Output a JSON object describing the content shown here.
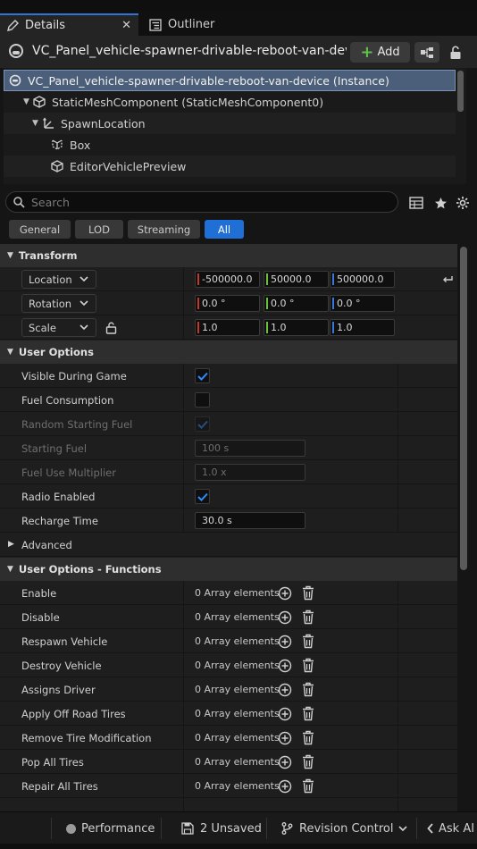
{
  "tabs": [
    {
      "label": "Details",
      "icon": "pencil-icon",
      "closable": true
    },
    {
      "label": "Outliner",
      "icon": "list-icon"
    }
  ],
  "header": {
    "actor_name": "VC_Panel_vehicle-spawner-drivable-reboot-van-device",
    "add_label": "Add"
  },
  "tree": [
    {
      "label": "VC_Panel_vehicle-spawner-drivable-reboot-van-device (Instance)",
      "icon": "actor-icon",
      "selected": true
    },
    {
      "label": "StaticMeshComponent (StaticMeshComponent0)",
      "icon": "cube-icon"
    },
    {
      "label": "SpawnLocation",
      "icon": "transform-icon"
    },
    {
      "label": "Box",
      "icon": "box-shape-icon"
    },
    {
      "label": "EditorVehiclePreview",
      "icon": "cube-icon"
    }
  ],
  "search": {
    "placeholder": "Search"
  },
  "filters": [
    "General",
    "LOD",
    "Streaming",
    "All"
  ],
  "active_filter": "All",
  "transform": {
    "title": "Transform",
    "rows": [
      {
        "label": "Location",
        "x": "-500000.0",
        "y": "50000.0",
        "z": "500000.0"
      },
      {
        "label": "Rotation",
        "x": "0.0 °",
        "y": "0.0 °",
        "z": "0.0 °"
      },
      {
        "label": "Scale",
        "x": "1.0",
        "y": "1.0",
        "z": "1.0"
      }
    ]
  },
  "user_options": {
    "title": "User Options",
    "rows": [
      {
        "label": "Visible During Game",
        "type": "checkbox",
        "checked": true,
        "enabled": true
      },
      {
        "label": "Fuel Consumption",
        "type": "checkbox",
        "checked": false,
        "enabled": true
      },
      {
        "label": "Random Starting Fuel",
        "type": "checkbox",
        "checked": true,
        "enabled": false
      },
      {
        "label": "Starting Fuel",
        "type": "number",
        "value": "100 s",
        "enabled": false
      },
      {
        "label": "Fuel Use Multiplier",
        "type": "number",
        "value": "1.0 x",
        "enabled": false
      },
      {
        "label": "Radio Enabled",
        "type": "checkbox",
        "checked": true,
        "enabled": true
      },
      {
        "label": "Recharge Time",
        "type": "number",
        "value": "30.0 s",
        "enabled": true
      }
    ]
  },
  "advanced_label": "Advanced",
  "functions": {
    "title": "User Options - Functions",
    "rows": [
      {
        "label": "Enable",
        "value": "0 Array elements"
      },
      {
        "label": "Disable",
        "value": "0 Array elements"
      },
      {
        "label": "Respawn Vehicle",
        "value": "0 Array elements"
      },
      {
        "label": "Destroy Vehicle",
        "value": "0 Array elements"
      },
      {
        "label": "Assigns Driver",
        "value": "0 Array elements"
      },
      {
        "label": "Apply Off Road Tires",
        "value": "0 Array elements"
      },
      {
        "label": "Remove Tire Modification",
        "value": "0 Array elements"
      },
      {
        "label": "Pop All Tires",
        "value": "0 Array elements"
      },
      {
        "label": "Repair All Tires",
        "value": "0 Array elements"
      }
    ]
  },
  "statusbar": {
    "performance": "Performance",
    "unsaved": "2 Unsaved",
    "revision_control": "Revision Control",
    "ask_ai": "Ask AI"
  },
  "colors": {
    "accent": "#1f6fd6",
    "selection": "#4b5f7a",
    "axis_x": "#c0392b",
    "axis_y": "#6cbf3a",
    "axis_z": "#3a78d6",
    "add_green": "#5fc04a"
  }
}
